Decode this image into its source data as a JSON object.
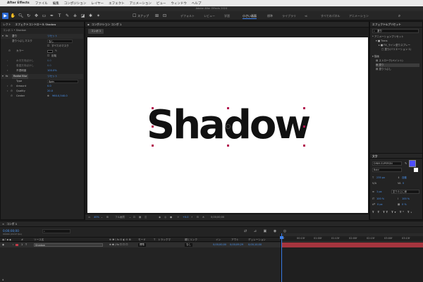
{
  "menubar": {
    "app_name": "After Effects",
    "items": [
      "ファイル",
      "編集",
      "コンポジション",
      "レイヤー",
      "エフェクト",
      "アニメーション",
      "ビュー",
      "ウィンドウ",
      "ヘルプ"
    ]
  },
  "window_title": "Adobe After Effects 2024",
  "toolbar": {
    "snap_label": "スナップ",
    "workspaces": [
      "デフォルト",
      "レビュー",
      "学習",
      "小さい画面",
      "標準",
      "ライブラリ",
      "≪",
      "すべてのパネル",
      "アニメーション"
    ],
    "active_workspace": "小さい画面"
  },
  "left_panel": {
    "tabs": [
      "レクト",
      "エフェクトコントロール Shadow"
    ],
    "breadcrumb": "コンポ 1 • Shadow",
    "rows": [
      {
        "label": "塗り",
        "value": "リセット"
      },
      {
        "label": "塗りつぶしマスク",
        "value": "なし"
      },
      {
        "label": "",
        "value": "すべてのマスク"
      },
      {
        "label": "カラー",
        "value": ""
      },
      {
        "label": "",
        "value": "反転"
      },
      {
        "label": "水平方向ぼかし",
        "value": "0.0"
      },
      {
        "label": "垂直方向ぼかし",
        "value": "0.0"
      },
      {
        "label": "不透明度",
        "value": "100.0%"
      },
      {
        "label": "Radial Blur",
        "value": "リセット"
      },
      {
        "label": "Type",
        "value": "Spin"
      },
      {
        "label": "Amount",
        "value": "0.0"
      },
      {
        "label": "Quality",
        "value": "20.0"
      },
      {
        "label": "Center",
        "value": "960.0,540.0"
      }
    ]
  },
  "viewer": {
    "tab_label": "コンポジション コンポ 1",
    "comp_tab": "コンポ 1",
    "canvas_text": "Shadow",
    "footer": {
      "zoom": "40%",
      "resolution": "フル画質",
      "exposure": "+0.0",
      "timecode": "0;00;00;00"
    }
  },
  "right_panel": {
    "effects_title": "エフェクト&プリセット",
    "search_value": "塗り",
    "tree": [
      "* アニメーションプリセット",
      "Trans",
      "FX_ライン塗りスプレー",
      "塗り(バリエーション 1)",
      "描画",
      "ストローク(ペイント)",
      "塗り",
      "塗りつぶし"
    ],
    "character_title": "文字",
    "font_name": "DINM-SUPERDN",
    "font_style": "Bold",
    "font_size": "235 px",
    "leading": "自動",
    "tracking": "0",
    "stroke_width": "1 px",
    "stroke_type": "塗りの上に線",
    "scale_v": "100 %",
    "scale_h": "100 %",
    "baseline": "0 px",
    "tsume": "0 %"
  },
  "timeline": {
    "tab_label": "コンポ 1",
    "timecode": "0;00;00;00",
    "frame_info": "00000 (29.97 fps)",
    "columns": [
      "#",
      "ソース名",
      "モード",
      "T",
      "トラックマ",
      "親とリンク",
      "イン",
      "アウト",
      "デュレーション"
    ],
    "layer": {
      "num": "1",
      "name": "Shadow",
      "mode": "標準",
      "parent": "なし",
      "in": "0;00;00;00",
      "out": "0;00;09;29",
      "duration": "0;00;10;00"
    },
    "ruler": [
      "0f",
      "00:15f",
      "01:00f",
      "01:15f",
      "02:00f",
      "02:15f",
      "03:00f",
      "03:15f"
    ]
  },
  "colors": {
    "accent": "#2d6bd6",
    "value_blue": "#4b95f2",
    "layer_bar": "#a5343e",
    "handle": "#b3124e"
  }
}
